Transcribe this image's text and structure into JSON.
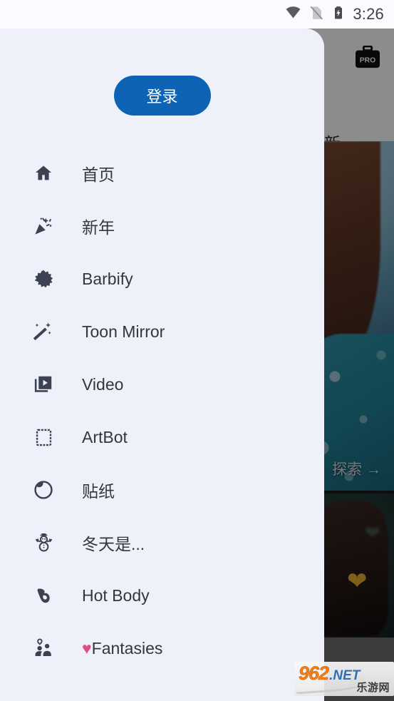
{
  "status_bar": {
    "time": "3:26",
    "icons": [
      "wifi-icon",
      "sim-card-off-icon",
      "battery-charging-icon"
    ]
  },
  "background_app": {
    "pro_badge_label": "PRO",
    "pro_badge_icon": "briefcase-pro-icon",
    "tab_label": "最新",
    "cards": [
      {
        "name": "winter-card",
        "overlay_label": "探索 →",
        "description": "winter illustration with teal puffer jacket"
      },
      {
        "name": "dark-portrait-card",
        "description": "dark portrait with gold heart sticker"
      }
    ],
    "bottom_nav_icon": "person-icon"
  },
  "drawer": {
    "login_label": "登录",
    "login_color": "#0f63b5",
    "background_color": "#eef1fa",
    "items": [
      {
        "label": "首页",
        "icon": "home-icon"
      },
      {
        "label": "新年",
        "icon": "celebration-icon"
      },
      {
        "label": "Barbify",
        "icon": "starburst-icon"
      },
      {
        "label": "Toon Mirror",
        "icon": "magic-wand-icon"
      },
      {
        "label": "Video",
        "icon": "video-library-icon"
      },
      {
        "label": "ArtBot",
        "icon": "stamp-frame-icon"
      },
      {
        "label": "贴纸",
        "icon": "sticker-icon"
      },
      {
        "label": "冬天是...",
        "icon": "snowman-icon"
      },
      {
        "label": "Hot Body",
        "icon": "biceps-icon"
      },
      {
        "label": "Fantasies",
        "icon": "couple-icon",
        "prefix_emoji": "♥",
        "prefix_color": "#e34d87"
      }
    ]
  },
  "watermark": {
    "number": "962",
    "domain": ".NET",
    "chinese": "乐游网",
    "number_color": "#ef7f1a",
    "domain_color": "#2f6fb5"
  }
}
